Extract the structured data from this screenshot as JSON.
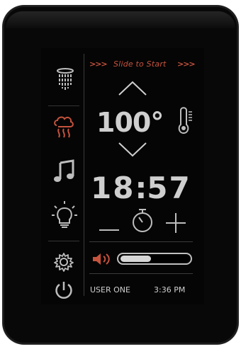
{
  "header": {
    "slide_label": "Slide to Start",
    "chevrons_left": ">>>",
    "chevrons_right": ">>>"
  },
  "controls": {
    "temperature": "100°",
    "timer_minutes": "18",
    "timer_colon": ":",
    "timer_seconds": "57",
    "volume_level": 0.45
  },
  "footer": {
    "user": "USER ONE",
    "time": "3:36 PM"
  },
  "sidebar": {
    "items": [
      {
        "name": "shower-icon",
        "active": false
      },
      {
        "name": "steam-icon",
        "active": true
      },
      {
        "name": "music-icon",
        "active": false
      },
      {
        "name": "light-icon",
        "active": false
      },
      {
        "name": "settings-icon",
        "active": false
      },
      {
        "name": "power-icon",
        "active": false
      }
    ]
  },
  "colors": {
    "accent": "#c6533d",
    "foreground": "#cfcfcf",
    "divider": "#3b3b3b",
    "background": "#050505"
  }
}
